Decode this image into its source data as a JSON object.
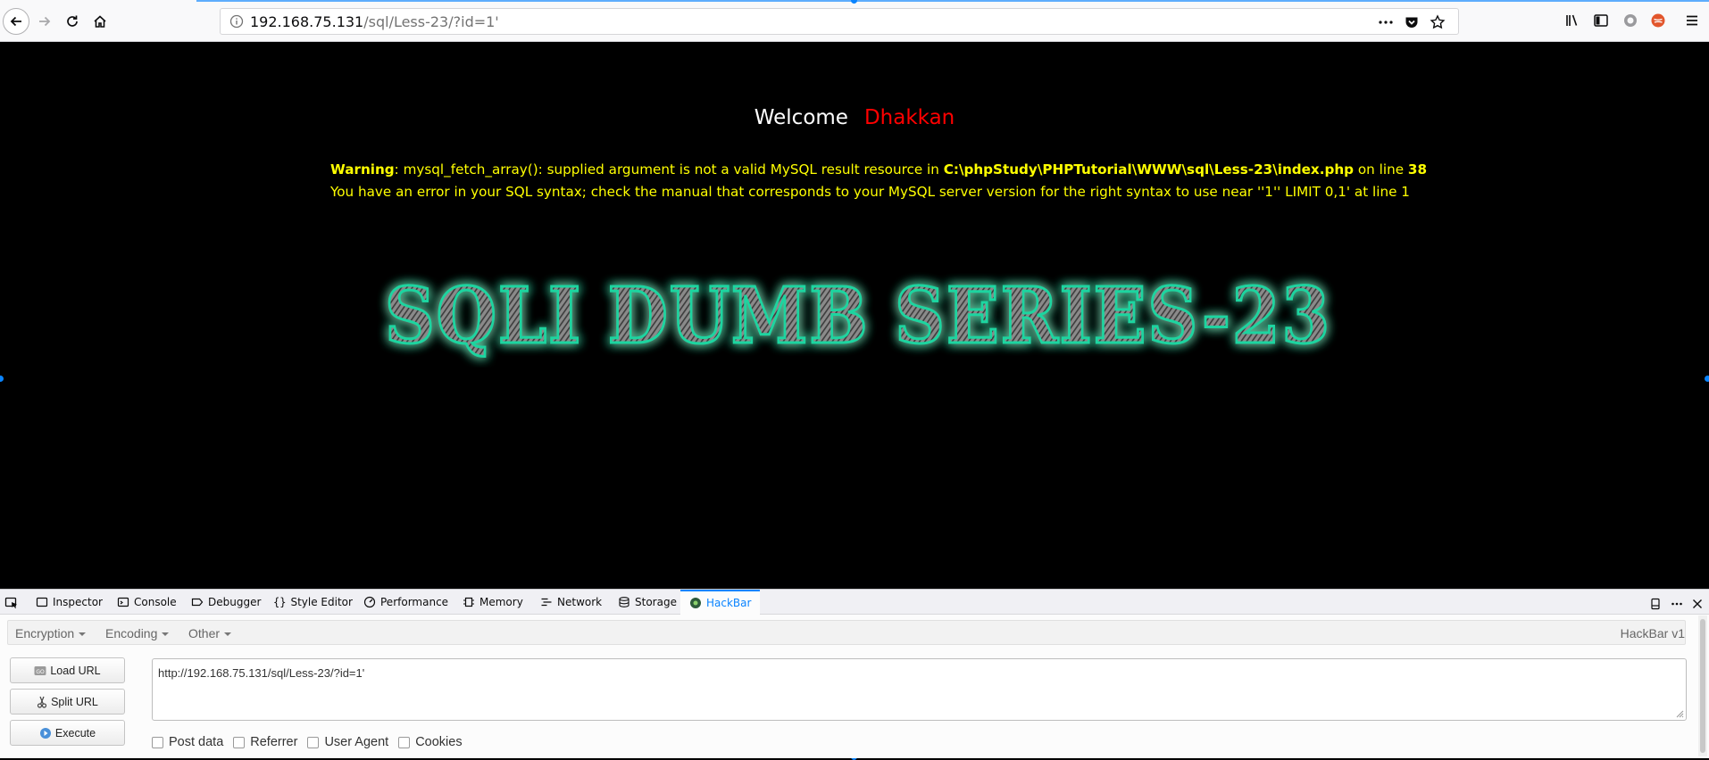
{
  "browser": {
    "url_host": "192.168.75.131",
    "url_path": "/sql/Less-23/?id=1'"
  },
  "page": {
    "welcome": "Welcome",
    "user": "Dhakkan",
    "warning_label": "Warning",
    "warning_text": ": mysql_fetch_array(): supplied argument is not a valid MySQL result resource in ",
    "warning_path": "C:\\phpStudy\\PHPTutorial\\WWW\\sql\\Less-23\\index.php",
    "warning_online": " on line ",
    "warning_line": "38",
    "sql_error": "You have an error in your SQL syntax; check the manual that corresponds to your MySQL server version for the right syntax to use near ''1'' LIMIT 0,1' at line 1",
    "banner": "SQLI DUMB SERIES-23"
  },
  "devtools": {
    "tabs": [
      {
        "label": "Inspector",
        "icon": "inspector-icon"
      },
      {
        "label": "Console",
        "icon": "console-icon"
      },
      {
        "label": "Debugger",
        "icon": "debugger-icon"
      },
      {
        "label": "Style Editor",
        "icon": "braces-icon"
      },
      {
        "label": "Performance",
        "icon": "performance-icon"
      },
      {
        "label": "Memory",
        "icon": "memory-icon"
      },
      {
        "label": "Network",
        "icon": "network-icon"
      },
      {
        "label": "Storage",
        "icon": "storage-icon"
      },
      {
        "label": "HackBar",
        "icon": "hackbar-icon",
        "active": true
      }
    ]
  },
  "hackbar": {
    "menu": {
      "encryption": "Encryption",
      "encoding": "Encoding",
      "other": "Other"
    },
    "version": "HackBar v1",
    "buttons": {
      "load_url": "Load URL",
      "split_url": "Split URL",
      "execute": "Execute"
    },
    "url_value": "http://192.168.75.131/sql/Less-23/?id=1'",
    "checkboxes": {
      "post_data": "Post data",
      "referrer": "Referrer",
      "user_agent": "User Agent",
      "cookies": "Cookies"
    }
  },
  "colors": {
    "accent": "#0a84ff",
    "warning_yellow": "#ffff00",
    "user_red": "#ff0000",
    "banner_glow": "#1fd5a0"
  }
}
